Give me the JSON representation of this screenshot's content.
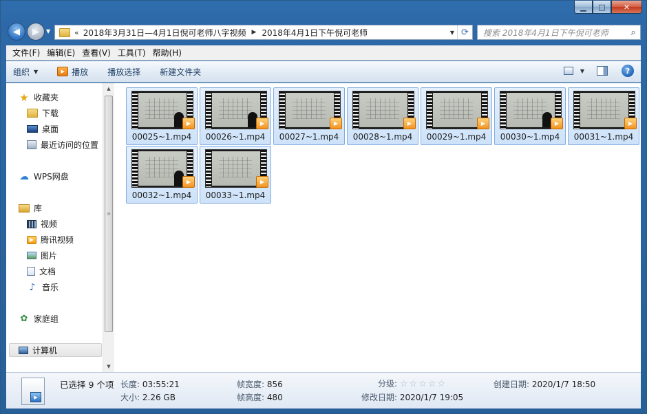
{
  "window": {
    "minimize_label": "▁",
    "maximize_label": "□",
    "close_label": "✕"
  },
  "address": {
    "overflow": "«",
    "segments": [
      "2018年3月31日—4月1日倪可老师八字视频",
      "2018年4月1日下午倪可老师"
    ],
    "separator": "▶"
  },
  "search": {
    "placeholder": "搜索 2018年4月1日下午倪可老师"
  },
  "menu": [
    "文件(F)",
    "编辑(E)",
    "查看(V)",
    "工具(T)",
    "帮助(H)"
  ],
  "toolbar": {
    "organize": "组织",
    "play": "播放",
    "play_selection": "播放选择",
    "new_folder": "新建文件夹"
  },
  "nav": {
    "favorites": "收藏夹",
    "downloads": "下载",
    "desktop": "桌面",
    "recent": "最近访问的位置",
    "wps": "WPS网盘",
    "libraries": "库",
    "videos": "视频",
    "tencent": "腾讯视频",
    "pictures": "图片",
    "documents": "文档",
    "music": "音乐",
    "homegroup": "家庭组",
    "computer": "计算机"
  },
  "files": [
    {
      "name": "00025~1.mp4",
      "figure": true
    },
    {
      "name": "00026~1.mp4",
      "figure": true
    },
    {
      "name": "00027~1.mp4",
      "figure": false
    },
    {
      "name": "00028~1.mp4",
      "figure": false
    },
    {
      "name": "00029~1.mp4",
      "figure": false
    },
    {
      "name": "00030~1.mp4",
      "figure": true
    },
    {
      "name": "00031~1.mp4",
      "figure": false
    },
    {
      "name": "00032~1.mp4",
      "figure": true
    },
    {
      "name": "00033~1.mp4",
      "figure": false
    }
  ],
  "details": {
    "selected": "已选择 9 个项",
    "length_key": "长度:",
    "length_val": "03:55:21",
    "size_key": "大小:",
    "size_val": "2.26 GB",
    "width_key": "帧宽度:",
    "width_val": "856",
    "height_key": "帧高度:",
    "height_val": "480",
    "rating_key": "分级:",
    "rating": 0,
    "modified_key": "修改日期:",
    "modified_val": "2020/1/7 19:05",
    "created_key": "创建日期:",
    "created_val": "2020/1/7 18:50"
  },
  "icons": {
    "back": "back-arrow-icon",
    "forward": "forward-arrow-icon",
    "refresh": "refresh-icon",
    "search": "magnifier-icon",
    "help": "help-icon"
  }
}
